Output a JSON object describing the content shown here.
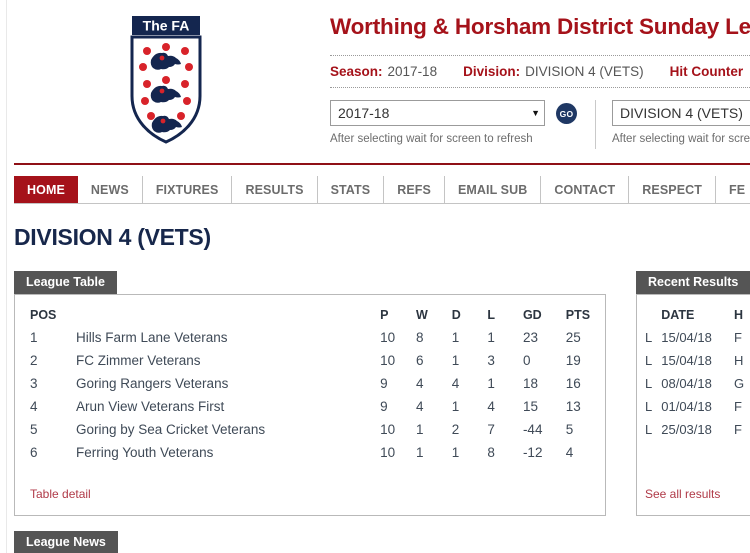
{
  "header": {
    "site_title": "Worthing & Horsham District Sunday League",
    "crest_banner": "The FA",
    "crest_alt": "fa-crest-icon",
    "meta": {
      "season_label": "Season:",
      "season_value": "2017-18",
      "division_label": "Division:",
      "division_value": "DIVISION 4 (VETS)",
      "hit_counter_label": "Hit Counter"
    },
    "selectors": [
      {
        "name": "season",
        "value": "2017-18",
        "caret": "▼",
        "hint": "After selecting wait for screen to refresh"
      },
      {
        "name": "division",
        "value": "DIVISION 4 (VETS)",
        "caret": "▼",
        "hint": "After selecting wait for scree"
      }
    ],
    "go_button": "GO"
  },
  "nav": {
    "items": [
      {
        "label": "HOME",
        "active": true
      },
      {
        "label": "NEWS",
        "active": false
      },
      {
        "label": "FIXTURES",
        "active": false
      },
      {
        "label": "RESULTS",
        "active": false
      },
      {
        "label": "STATS",
        "active": false
      },
      {
        "label": "REFS",
        "active": false
      },
      {
        "label": "EMAIL SUB",
        "active": false
      },
      {
        "label": "CONTACT",
        "active": false
      },
      {
        "label": "RESPECT",
        "active": false
      },
      {
        "label": "FE",
        "active": false
      }
    ]
  },
  "page_title": "DIVISION 4 (VETS)",
  "league_table": {
    "panel_title": "League Table",
    "columns": [
      "POS",
      "",
      "P",
      "W",
      "D",
      "L",
      "GD",
      "PTS"
    ],
    "rows": [
      {
        "pos": "1",
        "team": "Hills Farm Lane Veterans",
        "p": "10",
        "w": "8",
        "d": "1",
        "l": "1",
        "gd": "23",
        "pts": "25"
      },
      {
        "pos": "2",
        "team": "FC Zimmer Veterans",
        "p": "10",
        "w": "6",
        "d": "1",
        "l": "3",
        "gd": "0",
        "pts": "19"
      },
      {
        "pos": "3",
        "team": "Goring Rangers Veterans",
        "p": "9",
        "w": "4",
        "d": "4",
        "l": "1",
        "gd": "18",
        "pts": "16"
      },
      {
        "pos": "4",
        "team": "Arun View Veterans First",
        "p": "9",
        "w": "4",
        "d": "1",
        "l": "4",
        "gd": "15",
        "pts": "13"
      },
      {
        "pos": "5",
        "team": "Goring by Sea Cricket Veterans",
        "p": "10",
        "w": "1",
        "d": "2",
        "l": "7",
        "gd": "-44",
        "pts": "5"
      },
      {
        "pos": "6",
        "team": "Ferring Youth Veterans",
        "p": "10",
        "w": "1",
        "d": "1",
        "l": "8",
        "gd": "-12",
        "pts": "4"
      }
    ],
    "detail_link": "Table detail"
  },
  "recent_results": {
    "panel_title": "Recent Results",
    "columns": [
      "",
      "DATE",
      "H"
    ],
    "rows": [
      {
        "res": "L",
        "date": "15/04/18",
        "home": "F"
      },
      {
        "res": "L",
        "date": "15/04/18",
        "home": "H"
      },
      {
        "res": "L",
        "date": "08/04/18",
        "home": "G"
      },
      {
        "res": "L",
        "date": "01/04/18",
        "home": "F"
      },
      {
        "res": "L",
        "date": "25/03/18",
        "home": "F"
      }
    ],
    "see_all_link": "See all results"
  },
  "league_news": {
    "panel_title": "League News"
  },
  "colors": {
    "brand_red": "#A5121A",
    "navy": "#1F3864",
    "panel_gray": "#555555",
    "title_navy": "#17274B",
    "link_red": "#B03A48"
  }
}
